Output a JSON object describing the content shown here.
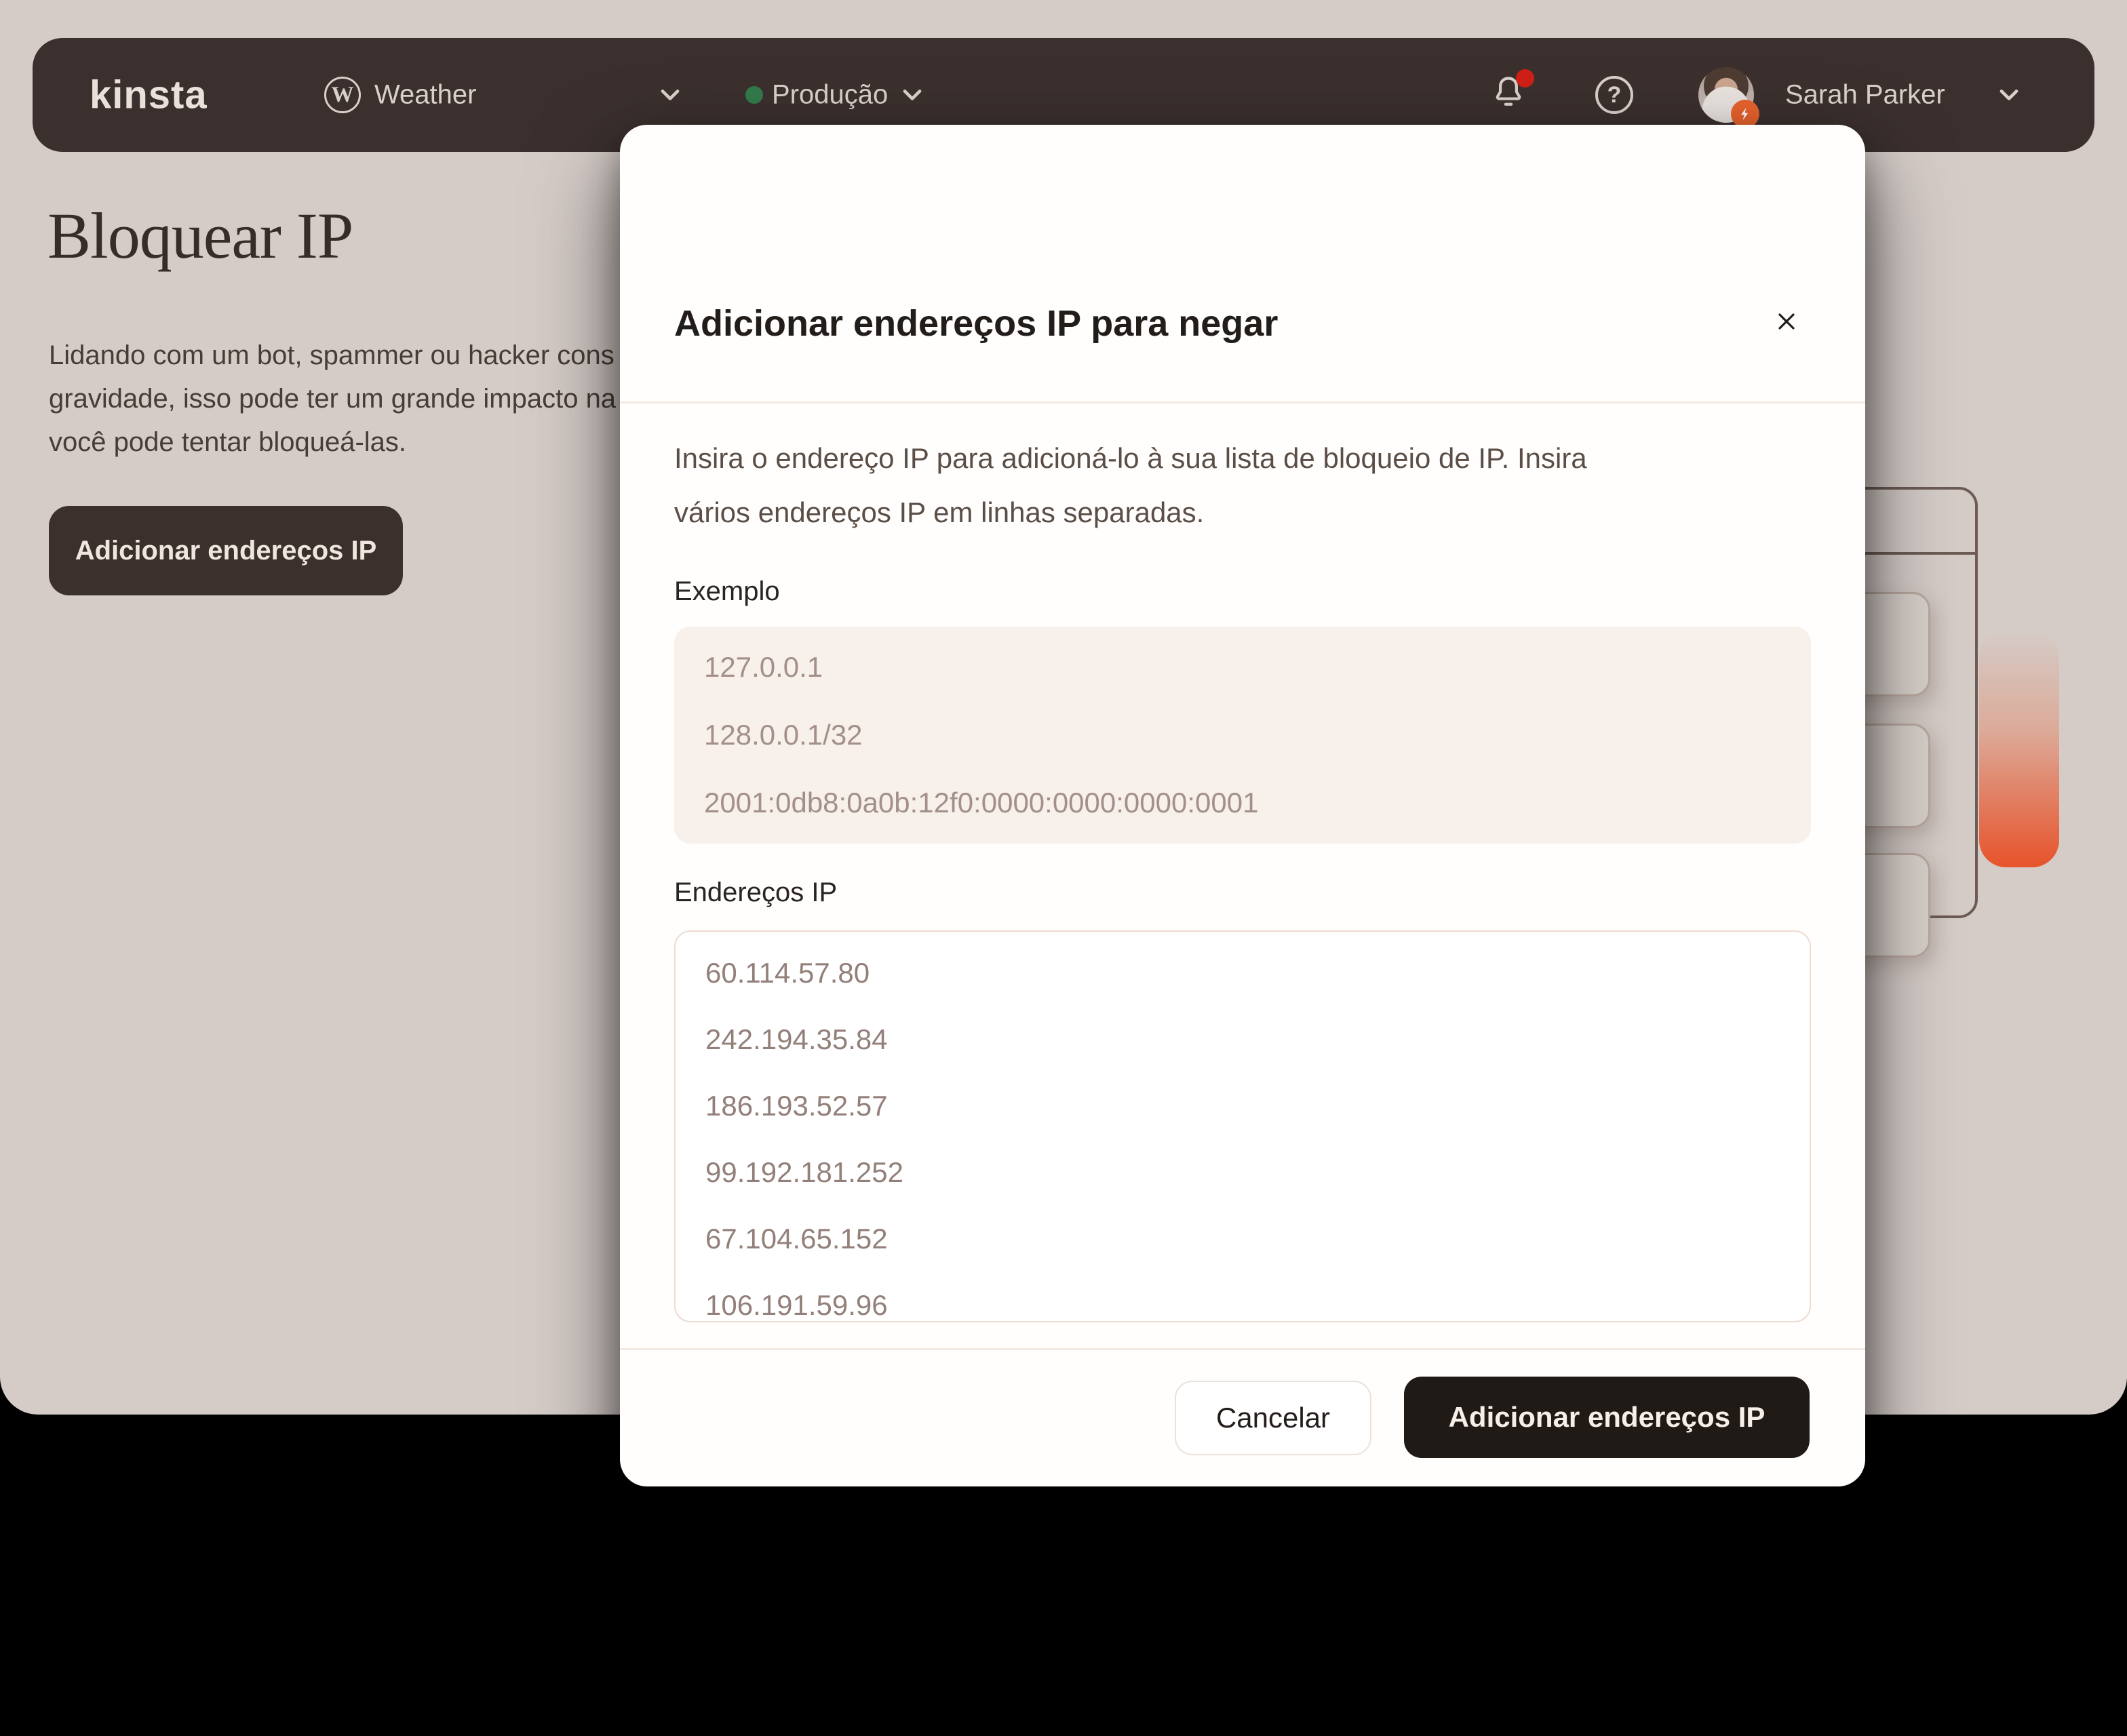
{
  "navbar": {
    "logo": "kinsta",
    "site_selector": {
      "glyph": "W",
      "label": "Weather"
    },
    "environment": {
      "label": "Produção",
      "status_color": "#327a4b"
    },
    "notification_color": "#cf2017",
    "help_glyph": "?",
    "user": {
      "name": "Sarah Parker"
    }
  },
  "page": {
    "title": "Bloquear IP",
    "paragraph_lines": [
      "Lidando com um bot, spammer ou hacker cons",
      "gravidade, isso pode ter um grande impacto na",
      "você pode tentar bloqueá-las."
    ],
    "add_button": "Adicionar endereços IP"
  },
  "modal": {
    "title": "Adicionar endereços IP para negar",
    "description_lines": [
      "Insira o endereço IP para adicioná-lo à sua lista de bloqueio de IP. Insira",
      "vários endereços IP em linhas separadas."
    ],
    "example": {
      "label": "Exemplo",
      "lines": [
        "127.0.0.1",
        "128.0.0.1/32",
        "2001:0db8:0a0b:12f0:0000:0000:0000:0001"
      ]
    },
    "ips": {
      "label": "Endereços IP",
      "value": "60.114.57.80\n242.194.35.84\n186.193.52.57\n99.192.181.252\n67.104.65.152\n106.191.59.96"
    },
    "footer": {
      "cancel": "Cancelar",
      "submit": "Adicionar endereços IP"
    }
  },
  "colors": {
    "page_background": "#d5ccc8",
    "navbar_background": "#3b302e",
    "brand_orange": "#e7532b",
    "status_green": "#327a4b",
    "notification_red": "#cf2017",
    "primary_button": "#201a17"
  }
}
